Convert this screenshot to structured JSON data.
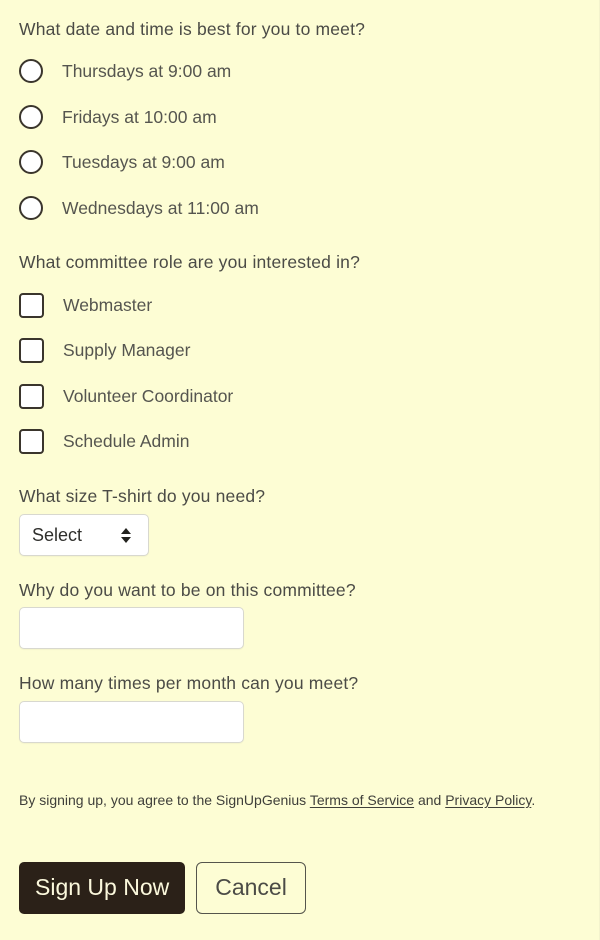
{
  "theme": {
    "page_background": "#FDFDD4",
    "text_color": "#4B4B46",
    "control_border": "#3A352C",
    "input_border": "#D8D8CF",
    "primary_button_background": "#2B2118",
    "primary_button_text": "#FBF8DC"
  },
  "form": {
    "questions": {
      "meeting_time": {
        "label": "What date and time is best for you to meet?",
        "type": "radio",
        "options": [
          {
            "label": "Thursdays at 9:00 am",
            "selected": false
          },
          {
            "label": "Fridays at 10:00 am",
            "selected": false
          },
          {
            "label": "Tuesdays at 9:00 am",
            "selected": false
          },
          {
            "label": "Wednesdays at 11:00 am",
            "selected": false
          }
        ]
      },
      "committee_role": {
        "label": "What committee role are you interested in?",
        "type": "checkbox",
        "options": [
          {
            "label": "Webmaster",
            "checked": false
          },
          {
            "label": "Supply Manager",
            "checked": false
          },
          {
            "label": "Volunteer Coordinator",
            "checked": false
          },
          {
            "label": "Schedule Admin",
            "checked": false
          }
        ]
      },
      "tshirt_size": {
        "label": "What size T-shirt do you need?",
        "type": "select",
        "value": "Select"
      },
      "why_committee": {
        "label": "Why do you want to be on this committee?",
        "type": "text",
        "value": "",
        "placeholder": ""
      },
      "times_per_month": {
        "label": "How many times per month can you meet?",
        "type": "text",
        "value": "",
        "placeholder": ""
      }
    }
  },
  "legal": {
    "prefix": "By signing up, you agree to the SignUpGenius ",
    "terms_link": "Terms of Service",
    "conjunction": " and ",
    "privacy_link": "Privacy Policy",
    "suffix": "."
  },
  "actions": {
    "submit_label": "Sign Up Now",
    "cancel_label": "Cancel"
  }
}
